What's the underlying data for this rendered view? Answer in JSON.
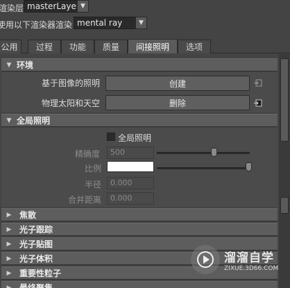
{
  "renderer": {
    "layer_label": "渲染层",
    "layer_value": "masterLayer",
    "use_label": "使用以下渲染器渲染",
    "use_value": "mental ray"
  },
  "tabs": [
    {
      "label": "公用"
    },
    {
      "label": "过程"
    },
    {
      "label": "功能"
    },
    {
      "label": "质量"
    },
    {
      "label": "间接照明"
    },
    {
      "label": "选项"
    }
  ],
  "active_tab": "间接照明",
  "environment": {
    "title": "环境",
    "ibl_label": "基于图像的照明",
    "ibl_button": "创建",
    "sky_label": "物理太阳和天空",
    "sky_button": "删除"
  },
  "gi": {
    "title": "全局照明",
    "checkbox_label": "全局照明",
    "checked": false,
    "accuracy_label": "精确度",
    "accuracy_value": "500",
    "scale_label": "比例",
    "scale_color": "#ffffff",
    "radius_label": "半径",
    "radius_value": "0.000",
    "merge_label": "合并距离",
    "merge_value": "0.000"
  },
  "collapsed_sections": [
    {
      "label": "焦散"
    },
    {
      "label": "光子跟踪"
    },
    {
      "label": "光子贴图"
    },
    {
      "label": "光子体积"
    },
    {
      "label": "重要性粒子"
    },
    {
      "label": "最终聚集"
    }
  ],
  "watermark": {
    "title": "溜溜自学",
    "url": "ZIXUE.3D66.COM"
  },
  "colors": {
    "background": "#444444",
    "header": "#5d5d5d",
    "button": "#5f5f5f"
  }
}
